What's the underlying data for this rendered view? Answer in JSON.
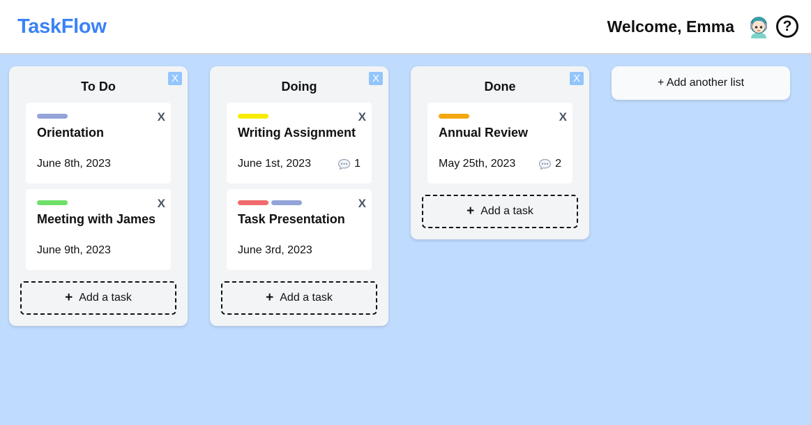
{
  "app": {
    "name": "TaskFlow"
  },
  "header": {
    "welcome": "Welcome, Emma",
    "help_glyph": "?"
  },
  "icons": {
    "avatar": "avatar-icon",
    "help": "help-icon",
    "comment": "comment-icon"
  },
  "colors": {
    "brand": "#3b82f6",
    "board_bg": "#bfdbfe",
    "label_slate": "#94a3d8",
    "label_green": "#6ee06a",
    "label_yellow": "#f7ec00",
    "label_red": "#f06b6b",
    "label_orange": "#f5a70f"
  },
  "close_glyph": "X",
  "add_glyph": "+",
  "lists": [
    {
      "title": "To Do",
      "add_task": "Add a task",
      "cards": [
        {
          "title": "Orientation",
          "date": "June 8th, 2023",
          "labels": [
            "#94a3d8"
          ],
          "comments": ""
        },
        {
          "title": "Meeting with James",
          "date": "June 9th, 2023",
          "labels": [
            "#6ee06a"
          ],
          "comments": ""
        }
      ]
    },
    {
      "title": "Doing",
      "add_task": "Add a task",
      "cards": [
        {
          "title": "Writing Assignment",
          "date": "June 1st, 2023",
          "labels": [
            "#f7ec00"
          ],
          "comments": "1"
        },
        {
          "title": "Task Presentation",
          "date": "June 3rd, 2023",
          "labels": [
            "#f06b6b",
            "#94a3d8"
          ],
          "comments": ""
        }
      ]
    },
    {
      "title": "Done",
      "add_task": "Add a task",
      "cards": [
        {
          "title": "Annual Review",
          "date": "May 25th, 2023",
          "labels": [
            "#f5a70f"
          ],
          "comments": "2"
        }
      ]
    }
  ],
  "add_list": "+ Add another list"
}
